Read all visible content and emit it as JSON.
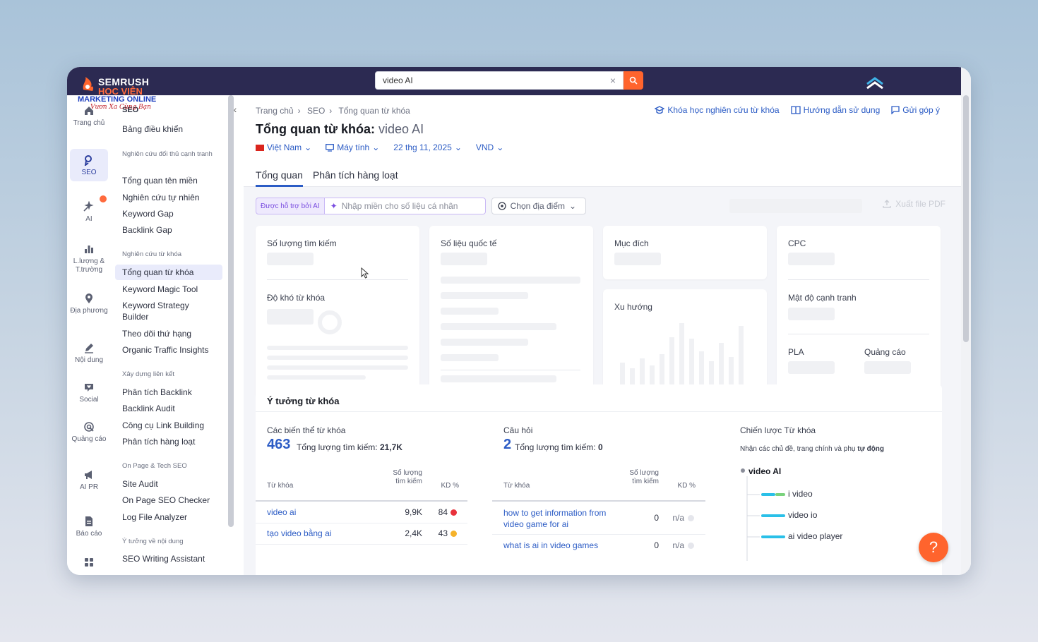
{
  "brand": {
    "logo_main": "SEMRUSH",
    "logo_sub": "HỌC VIỆN",
    "line1": "MARKETING ONLINE",
    "line2": "Vươn Xa Cùng Bạn"
  },
  "search": {
    "value": "video AI",
    "clear": "×"
  },
  "rail": [
    {
      "label": "Trang chủ",
      "icon": "home-icon"
    },
    {
      "label": "SEO",
      "icon": "seo-icon"
    },
    {
      "label": "AI",
      "icon": "ai-sparkle-icon"
    },
    {
      "label": "L.lượng & T.trường",
      "icon": "bar-chart-icon"
    },
    {
      "label": "Địa phương",
      "icon": "map-pin-icon"
    },
    {
      "label": "Nội dung",
      "icon": "pen-icon"
    },
    {
      "label": "Social",
      "icon": "heart-chat-icon"
    },
    {
      "label": "Quảng cáo",
      "icon": "target-icon"
    },
    {
      "label": "AI PR",
      "icon": "megaphone-icon"
    },
    {
      "label": "Báo cáo",
      "icon": "report-icon"
    }
  ],
  "menu": {
    "title": "SEO",
    "dashboard": "Bảng điều khiển",
    "group1": "Nghiên cứu đối thủ cạnh tranh",
    "g1_items": [
      "Tổng quan tên miền",
      "Nghiên cứu tự nhiên",
      "Keyword Gap",
      "Backlink Gap"
    ],
    "group2": "Nghiên cứu từ khóa",
    "g2_items": [
      "Tổng quan từ khóa",
      "Keyword Magic Tool",
      "Keyword Strategy Builder",
      "Theo dõi thứ hạng",
      "Organic Traffic Insights"
    ],
    "group3": "Xây dựng liên kết",
    "g3_items": [
      "Phân tích Backlink",
      "Backlink Audit",
      "Công cụ Link Building",
      "Phân tích hàng loạt"
    ],
    "group4": "On Page & Tech SEO",
    "g4_items": [
      "Site Audit",
      "On Page SEO Checker",
      "Log File Analyzer"
    ],
    "group5": "Ý tưởng về nội dung",
    "g5_items": [
      "SEO Writing Assistant"
    ]
  },
  "breadcrumb": [
    "Trang chủ",
    "SEO",
    "Tổng quan từ khóa"
  ],
  "top_links": [
    "Khóa học nghiên cứu từ khóa",
    "Hướng dẫn sử dụng",
    "Gửi góp ý"
  ],
  "page": {
    "title": "Tổng quan từ khóa:",
    "keyword": "video AI"
  },
  "filters": {
    "country": "Việt Nam",
    "device": "Máy tính",
    "date": "22 thg 11, 2025",
    "currency": "VND"
  },
  "tabs": [
    "Tổng quan",
    "Phân tích hàng loạt"
  ],
  "tools": {
    "ai_badge": "Được hỗ trợ bởi AI",
    "ai_placeholder": "Nhập miền cho số liệu cá nhân",
    "location": "Chọn địa điểm",
    "export": "Xuất file PDF"
  },
  "cards": {
    "volume": "Số lượng tìm kiếm",
    "difficulty": "Độ khó từ khóa",
    "global": "Số liệu quốc tế",
    "intent": "Mục đích",
    "trend": "Xu hướng",
    "cpc": "CPC",
    "competition": "Mật độ cạnh tranh",
    "pla": "PLA",
    "ads": "Quảng cáo"
  },
  "ideas": {
    "title": "Ý tưởng từ khóa",
    "variants": {
      "title": "Các biến thể từ khóa",
      "count": "463",
      "total_label": "Tổng lượng tìm kiếm:",
      "total": "21,7K",
      "headers": {
        "keyword": "Từ khóa",
        "volume": "Số lượng tìm kiếm",
        "kd": "KD %"
      },
      "rows": [
        {
          "keyword": "video ai",
          "volume": "9,9K",
          "kd": "84",
          "color": "#e8323c"
        },
        {
          "keyword": "tạo video bằng ai",
          "volume": "2,4K",
          "kd": "43",
          "color": "#f5b22a"
        }
      ]
    },
    "questions": {
      "title": "Câu hỏi",
      "count": "2",
      "total_label": "Tổng lượng tìm kiếm:",
      "total": "0",
      "headers": {
        "keyword": "Từ khóa",
        "volume": "Số lượng tìm kiếm",
        "kd": "KD %"
      },
      "rows": [
        {
          "keyword": "how to get information from video game for ai",
          "volume": "0",
          "kd": "n/a"
        },
        {
          "keyword": "what is ai in video games",
          "volume": "0",
          "kd": "n/a"
        }
      ]
    },
    "strategy": {
      "title": "Chiến lược Từ khóa",
      "sub_prefix": "Nhận các chủ đề, trang chính và phụ",
      "sub_bold": "tự động",
      "root": "video AI",
      "nodes": [
        "i video",
        "video io",
        "ai video player"
      ]
    }
  },
  "help": "?"
}
